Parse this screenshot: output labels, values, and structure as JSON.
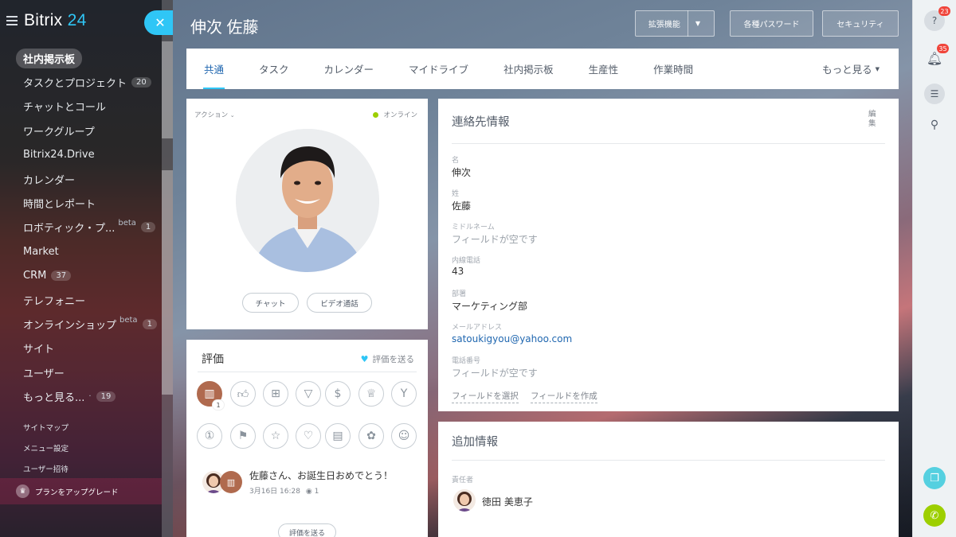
{
  "app": {
    "logo_name": "Bitrix",
    "logo_suffix": "24"
  },
  "sidebar": {
    "items": [
      {
        "label": "社内掲示板",
        "active": true
      },
      {
        "label": "タスクとプロジェクト",
        "count": "20"
      },
      {
        "label": "チャットとコール"
      },
      {
        "label": "ワークグループ"
      },
      {
        "label": "Bitrix24.Drive"
      },
      {
        "label": "カレンダー"
      },
      {
        "label": "時間とレポート"
      },
      {
        "label": "ロボティック・プ...",
        "beta": "beta",
        "count": "1"
      },
      {
        "label": "Market"
      },
      {
        "label": "CRM",
        "count": "37"
      },
      {
        "label": "テレフォニー"
      },
      {
        "label": "オンラインショップ",
        "beta": "beta",
        "count": "1"
      },
      {
        "label": "サイト"
      },
      {
        "label": "ユーザー"
      },
      {
        "label": "もっと見る...",
        "suffix": "·",
        "count": "19"
      }
    ],
    "sitemap": "サイトマップ",
    "menu_settings": "メニュー設定",
    "invite": "ユーザー招待",
    "upgrade": "プランをアップグレード"
  },
  "header": {
    "title": "伸次 佐藤",
    "btn_extensions": "拡張機能",
    "btn_passwords": "各種パスワード",
    "btn_security": "セキュリティ"
  },
  "tabs": {
    "items": [
      "共通",
      "タスク",
      "カレンダー",
      "マイドライブ",
      "社内掲示板",
      "生産性",
      "作業時間"
    ],
    "more": "もっと見る"
  },
  "profile": {
    "actions": "アクション",
    "status": "オンライン",
    "chat": "チャット",
    "video": "ビデオ通話"
  },
  "rating": {
    "title": "評価",
    "send": "評価を送る",
    "badge_count": "1",
    "post_text": "佐藤さん、お誕生日おめでとう！",
    "post_date": "3月16日 16:28",
    "post_views": "1",
    "send_button": "評価を送る"
  },
  "contact": {
    "title": "連絡先情報",
    "edit": "編集",
    "fields": [
      {
        "label": "名",
        "value": "伸次"
      },
      {
        "label": "姓",
        "value": "佐藤"
      },
      {
        "label": "ミドルネーム",
        "value": "フィールドが空です"
      },
      {
        "label": "内線電話",
        "value": "43"
      },
      {
        "label": "部署",
        "value": "マーケティング部"
      },
      {
        "label": "メールアドレス",
        "value": "satoukigyou@yahoo.com"
      },
      {
        "label": "電話番号",
        "value": "フィールドが空です"
      }
    ],
    "select_field": "フィールドを選択",
    "create_field": "フィールドを作成"
  },
  "additional": {
    "title": "追加情報",
    "manager_label": "責任者",
    "manager_name": "徳田 美恵子"
  },
  "right_panel": {
    "help_count": "23",
    "notif_count": "35"
  },
  "colors": {
    "accent": "#2fc6f6",
    "link": "#2067b0",
    "online": "#9dcf00",
    "call": "#9dcf00"
  }
}
